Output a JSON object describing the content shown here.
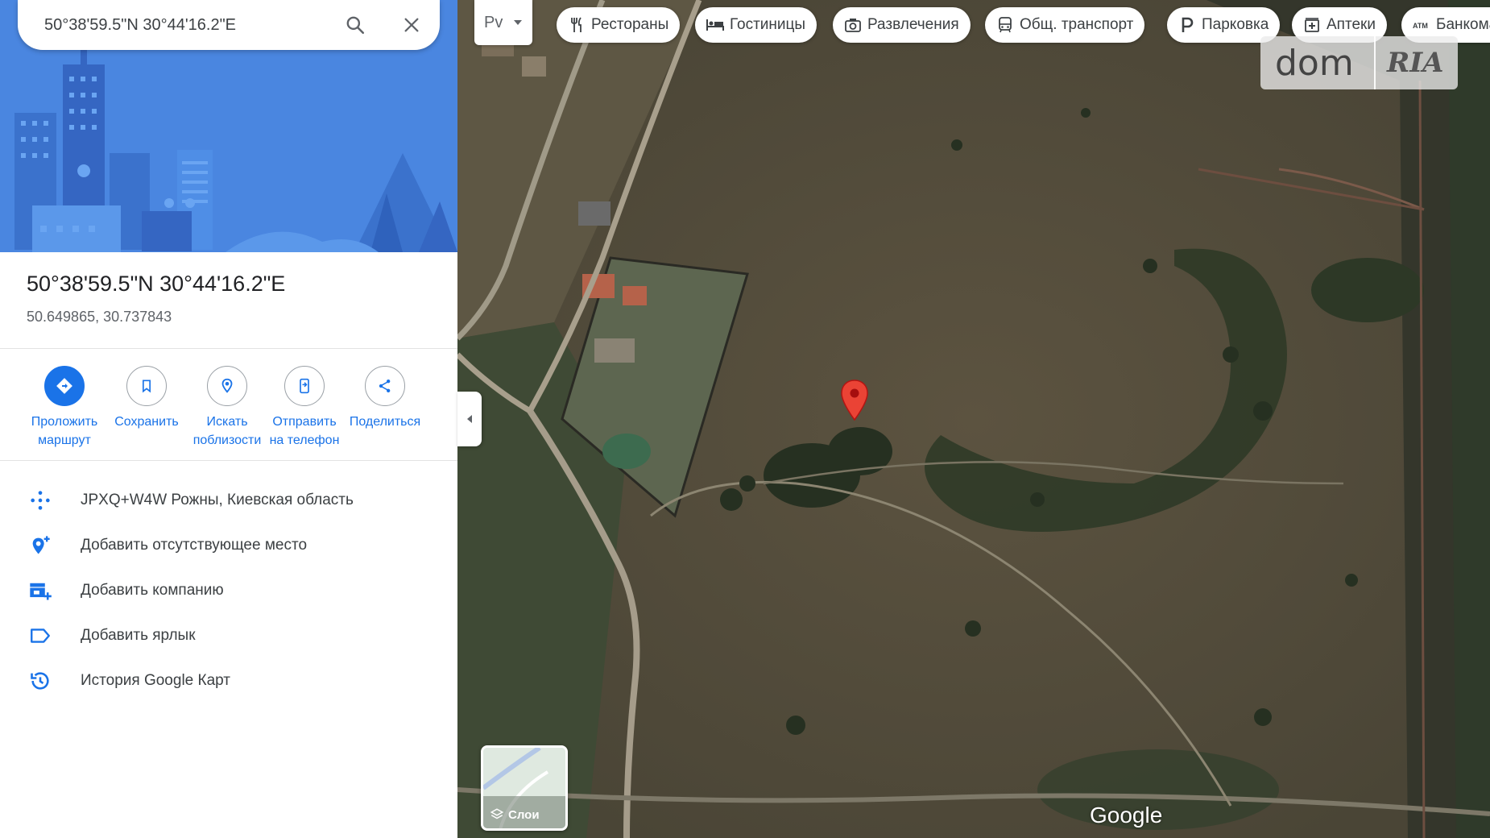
{
  "search": {
    "query": "50°38'59.5\"N 30°44'16.2\"E",
    "search_icon": "search-icon",
    "close_icon": "close-icon"
  },
  "place": {
    "title": "50°38'59.5\"N 30°44'16.2\"E",
    "decimal": "50.649865, 30.737843"
  },
  "actions": [
    {
      "label_line1": "Проложить",
      "label_line2": "маршрут",
      "icon": "directions-icon"
    },
    {
      "label_line1": "Сохранить",
      "label_line2": "",
      "icon": "bookmark-icon"
    },
    {
      "label_line1": "Искать",
      "label_line2": "поблизости",
      "icon": "nearby-icon"
    },
    {
      "label_line1": "Отправить",
      "label_line2": "на телефон",
      "icon": "send-to-phone-icon"
    },
    {
      "label_line1": "Поделиться",
      "label_line2": "",
      "icon": "share-icon"
    }
  ],
  "info": [
    {
      "text": "JPXQ+W4W Рожны, Киевская область",
      "icon": "plus-code-icon"
    },
    {
      "text": "Добавить отсутствующее место",
      "icon": "add-place-icon"
    },
    {
      "text": "Добавить компанию",
      "icon": "add-business-icon"
    },
    {
      "text": "Добавить ярлык",
      "icon": "label-icon"
    },
    {
      "text": "История Google Карт",
      "icon": "history-icon"
    }
  ],
  "map": {
    "lang_label": "Рv",
    "chips": [
      {
        "label": "Рестораны",
        "icon": "restaurant-icon"
      },
      {
        "label": "Гостиницы",
        "icon": "hotel-icon"
      },
      {
        "label": "Развлечения",
        "icon": "camera-icon"
      },
      {
        "label": "Общ. транспорт",
        "icon": "transit-icon"
      },
      {
        "label": "Парковка",
        "icon": "parking-icon"
      },
      {
        "label": "Аптеки",
        "icon": "pharmacy-icon"
      },
      {
        "label": "Банкоматы",
        "icon": "atm-icon"
      }
    ],
    "layers_label": "Слои",
    "google_label": "Google",
    "watermark": {
      "dom": "dom",
      "ria": "RIA"
    }
  },
  "colors": {
    "accent": "#1a73e8",
    "hero_bg": "#4a86e0",
    "pin": "#ea4335"
  }
}
